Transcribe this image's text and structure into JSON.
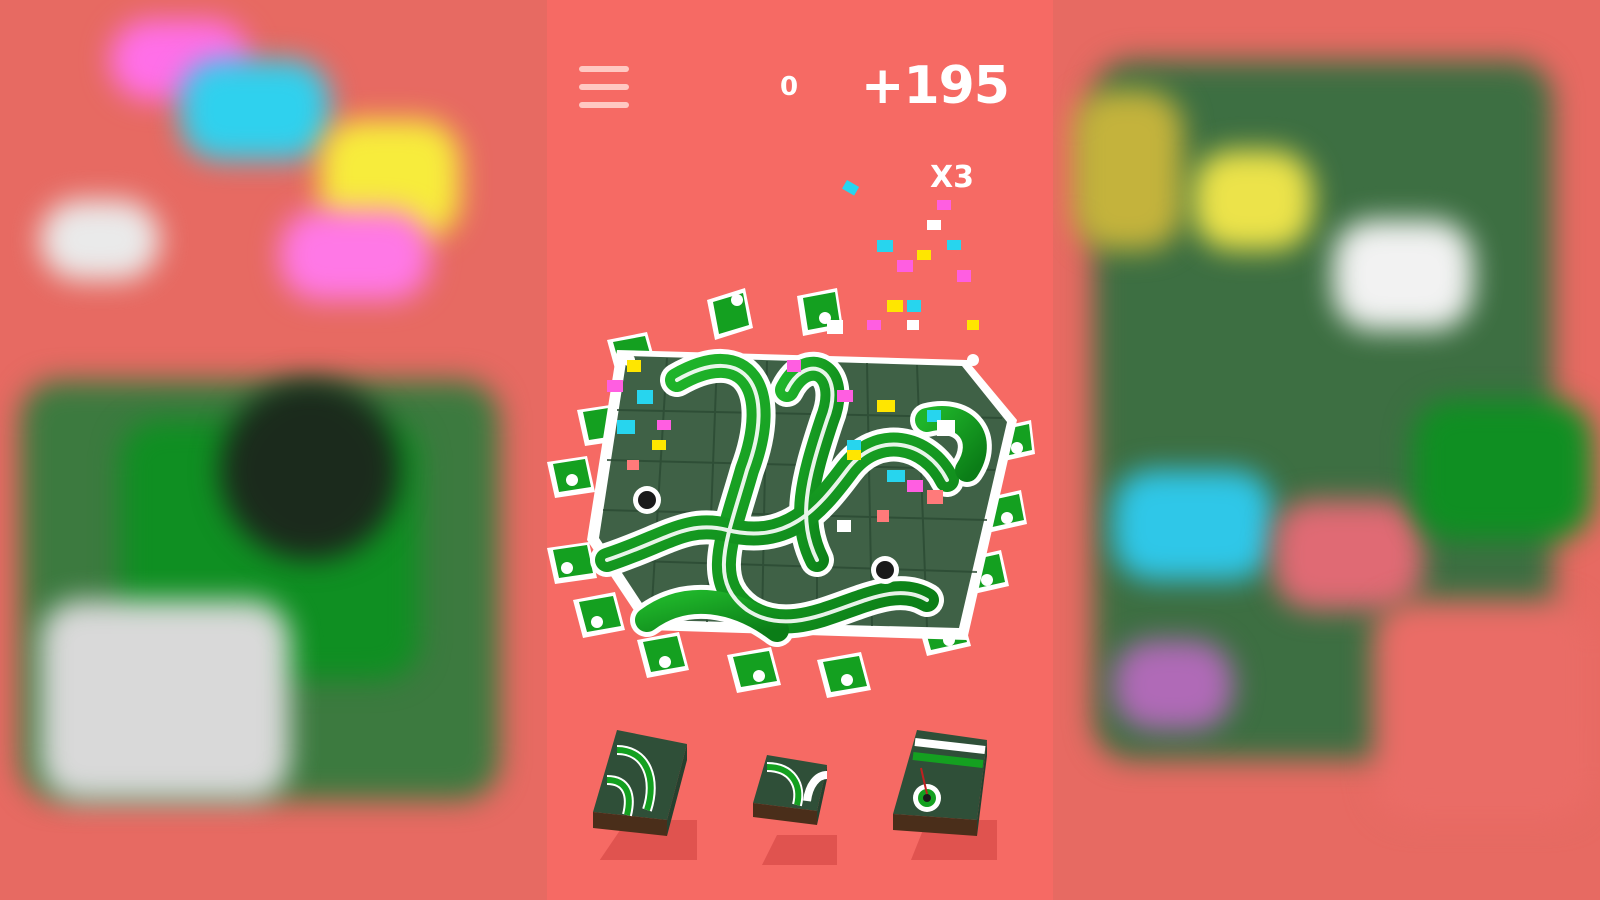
{
  "hud": {
    "score": "0",
    "bonus": "+195",
    "multiplier": "X3"
  },
  "icons": {
    "menu": "hamburger-menu-icon"
  },
  "colors": {
    "background": "#f66a64",
    "track_green": "#129a1a",
    "board_dark": "#2f4f38",
    "rail_white": "#ffffff",
    "confetti": [
      "#ff5ee1",
      "#27d5ee",
      "#ffe600",
      "#ffffff",
      "#ff7a7a"
    ]
  },
  "pieces": [
    {
      "id": "piece-1",
      "kind": "double-curve-tall"
    },
    {
      "id": "piece-2",
      "kind": "double-curve-small"
    },
    {
      "id": "piece-3",
      "kind": "straight-with-hole"
    }
  ]
}
